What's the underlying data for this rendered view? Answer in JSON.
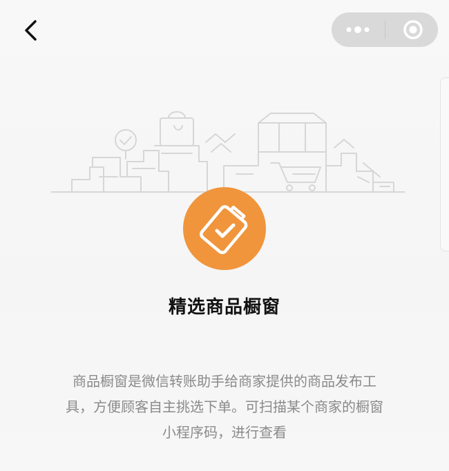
{
  "header": {
    "back_icon": "chevron-left-icon",
    "capsule": {
      "more_icon": "more-dots-icon",
      "close_icon": "target-close-icon"
    }
  },
  "illustration": {
    "icon": "shopping-street-illustration"
  },
  "badge": {
    "icon": "clipboard-check-icon",
    "color": "#F0953C"
  },
  "main": {
    "title": "精选商品橱窗",
    "description": "商品橱窗是微信转账助手给商家提供的商品发布工具，方便顾客自主挑选下单。可扫描某个商家的橱窗小程序码，进行查看"
  },
  "colors": {
    "accent": "#F0953C",
    "background": "#F6F6F6",
    "text_primary": "#111111",
    "text_secondary": "#8A8A8A",
    "capsule": "#D9D9D9"
  }
}
